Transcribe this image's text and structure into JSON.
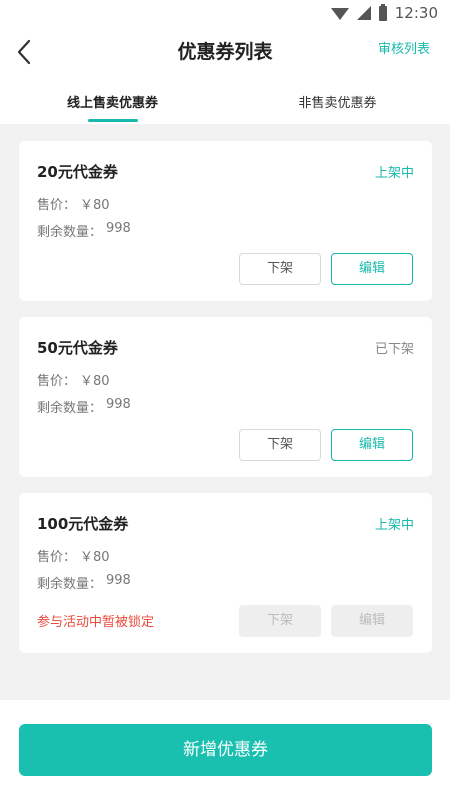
{
  "status_bar": {
    "time": "12:30"
  },
  "header": {
    "title": "优惠券列表",
    "action": "审核列表"
  },
  "tabs": [
    {
      "label": "线上售卖优惠券",
      "active": true
    },
    {
      "label": "非售卖优惠券",
      "active": false
    }
  ],
  "coupons": [
    {
      "name": "20元代金券",
      "status": "上架中",
      "price_label": "售价：",
      "price": "￥80",
      "stock_label": "剩余数量：",
      "stock": "998",
      "lock_note": "",
      "offshelf_label": "下架",
      "edit_label": "编辑"
    },
    {
      "name": "50元代金券",
      "status": "已下架",
      "price_label": "售价：",
      "price": "￥80",
      "stock_label": "剩余数量：",
      "stock": "998",
      "lock_note": "",
      "offshelf_label": "下架",
      "edit_label": "编辑"
    },
    {
      "name": "100元代金券",
      "status": "上架中",
      "price_label": "售价：",
      "price": "￥80",
      "stock_label": "剩余数量：",
      "stock": "998",
      "lock_note": "参与活动中暂被锁定",
      "offshelf_label": "下架",
      "edit_label": "编辑"
    }
  ],
  "footer": {
    "add_label": "新增优惠券"
  },
  "colors": {
    "accent": "#19b9ad",
    "warning": "#e84c3d"
  }
}
